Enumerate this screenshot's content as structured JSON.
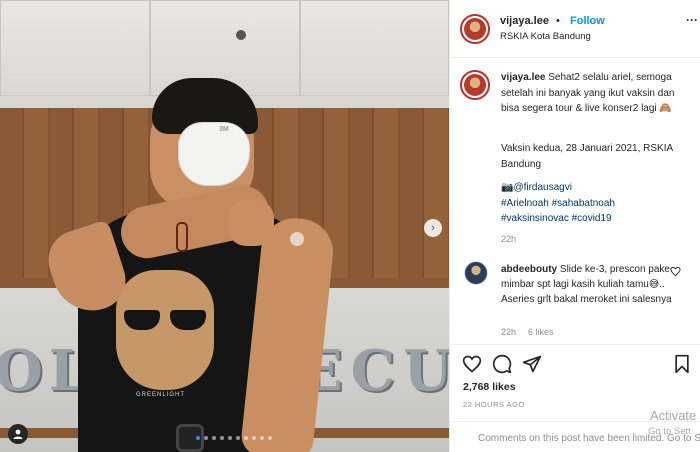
{
  "post": {
    "username": "vijaya.lee",
    "separator": "•",
    "follow_label": "Follow",
    "location": "RSKIA Kota Bandung",
    "more_icon": "more-horizontal-icon"
  },
  "caption": {
    "username": "vijaya.lee",
    "text_line1": "Sehat2 selalu ariel, semoga setelah ini banyak yang ikut vaksin dan bisa segera tour & live konser2 lagi 🙈",
    "text_line2": "Vaksin kedua, 28 Januari 2021, RSKIA Bandung",
    "photo_credit_icon": "camera-icon",
    "photo_credit": "@firdausagvi",
    "hashtags_line1": "#Arielnoah #sahabatnoah",
    "hashtags_line2": "#vaksinsinovac #covid19",
    "time": "22h"
  },
  "comment": {
    "username": "abdeebouty",
    "text": "Slide ke-3, prescon pake mimbar spt lagi kasih kuliah tamu😅.. Aseries grlt bakal meroket ini salesnya",
    "time": "22h",
    "likes": "6 likes"
  },
  "actions": {
    "likes": "2,768 likes",
    "date": "22 HOURS AGO",
    "comments_off": "Comments on this post have been limited. Go to Sett"
  },
  "carousel": {
    "dot_count": 10,
    "active_index": 0
  },
  "photo": {
    "wall_text_left": "OL",
    "wall_text_right": "ECU",
    "mask_brand": "3M",
    "shirt_print": "GREENLIGHT"
  },
  "windows": {
    "activate_title": "Activate",
    "activate_sub": "Go to Sett"
  },
  "colors": {
    "link_blue": "#0095f6",
    "hashtag": "#00376b",
    "muted": "#8e8e8e",
    "avatar_ring": "#c42a2a"
  }
}
